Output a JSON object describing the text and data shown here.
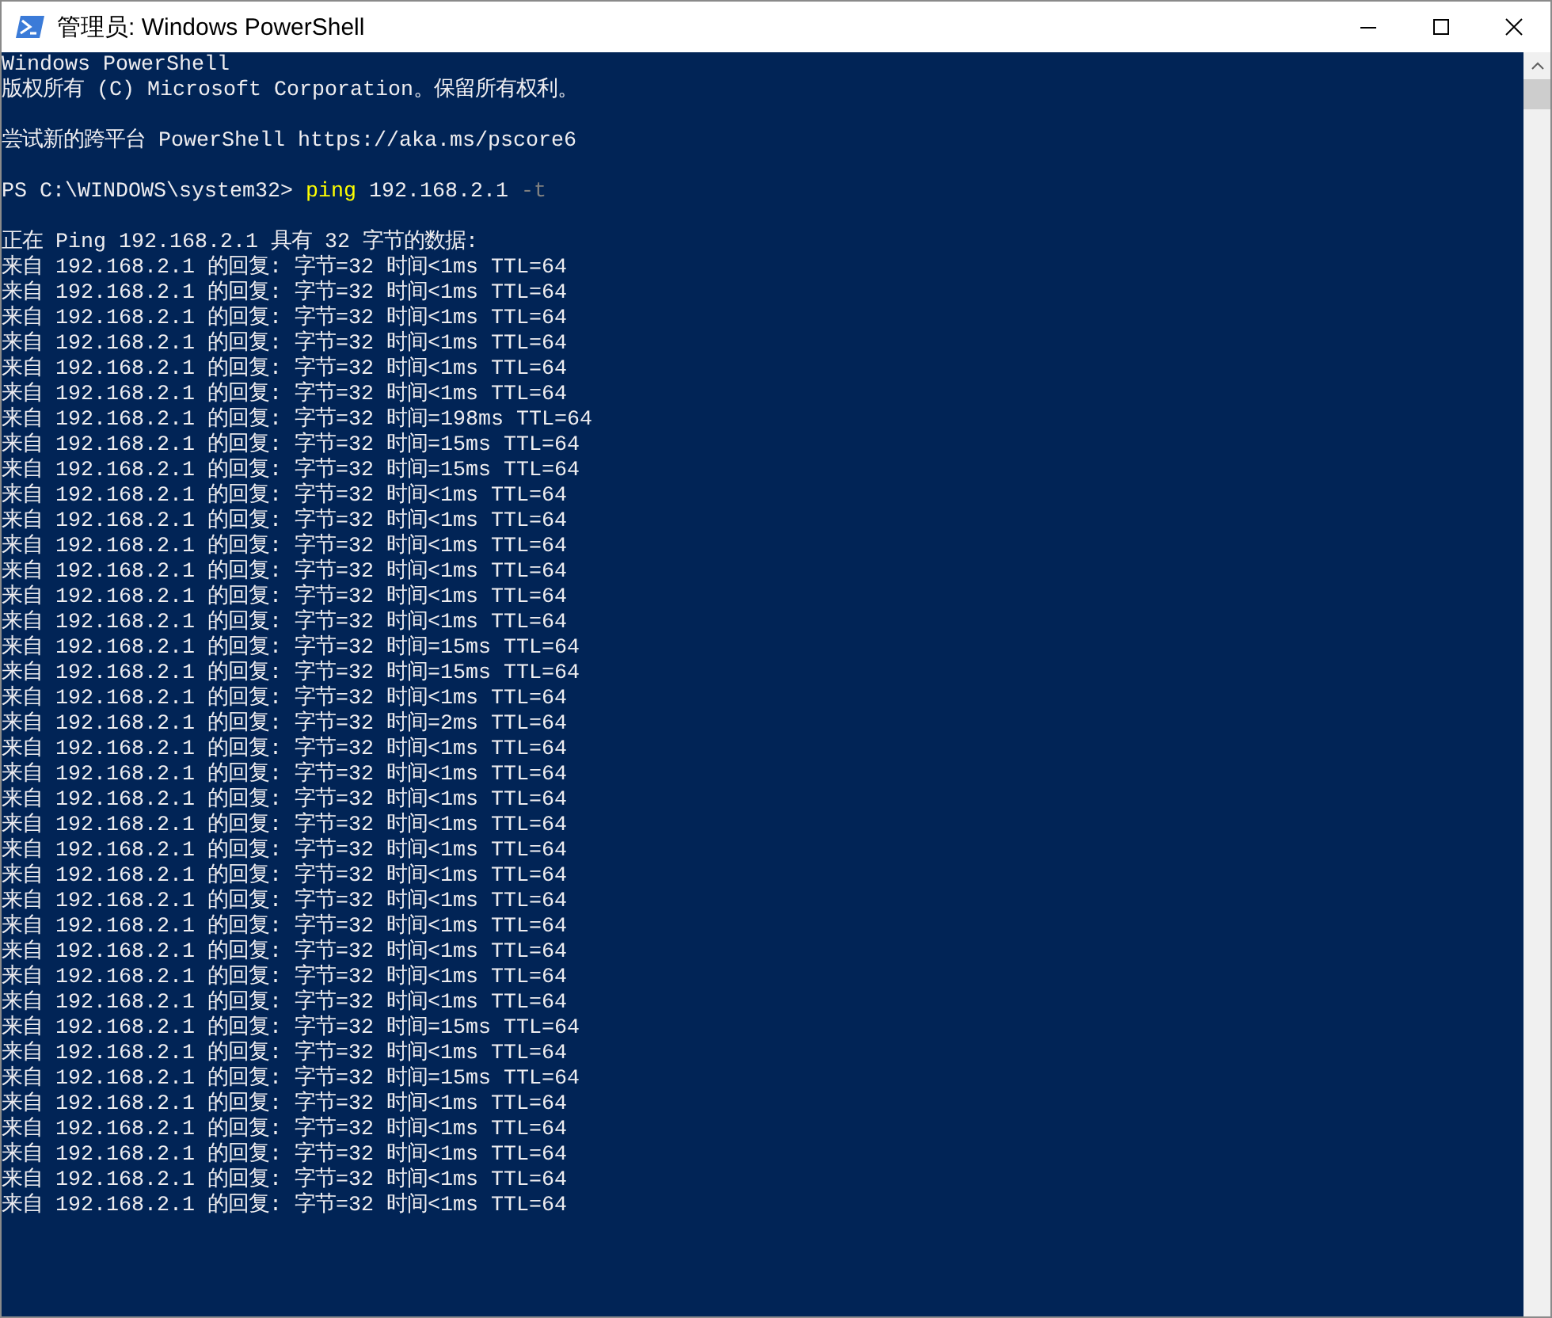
{
  "window": {
    "title": "管理员: Windows PowerShell"
  },
  "console": {
    "blocks": [
      {
        "kind": "text",
        "lines": [
          "Windows PowerShell",
          "版权所有 (C) Microsoft Corporation。保留所有权利。"
        ]
      },
      {
        "kind": "text",
        "lines": [
          "尝试新的跨平台 PowerShell https://aka.ms/pscore6"
        ]
      },
      {
        "kind": "command",
        "prompt": "PS C:\\WINDOWS\\system32>",
        "command": "ping",
        "argument": "192.168.2.1",
        "flag": "-t"
      },
      {
        "kind": "text",
        "lines": [
          "正在 Ping 192.168.2.1 具有 32 字节的数据:",
          "来自 192.168.2.1 的回复: 字节=32 时间<1ms TTL=64",
          "来自 192.168.2.1 的回复: 字节=32 时间<1ms TTL=64",
          "来自 192.168.2.1 的回复: 字节=32 时间<1ms TTL=64",
          "来自 192.168.2.1 的回复: 字节=32 时间<1ms TTL=64",
          "来自 192.168.2.1 的回复: 字节=32 时间<1ms TTL=64",
          "来自 192.168.2.1 的回复: 字节=32 时间<1ms TTL=64",
          "来自 192.168.2.1 的回复: 字节=32 时间=198ms TTL=64",
          "来自 192.168.2.1 的回复: 字节=32 时间=15ms TTL=64",
          "来自 192.168.2.1 的回复: 字节=32 时间=15ms TTL=64",
          "来自 192.168.2.1 的回复: 字节=32 时间<1ms TTL=64",
          "来自 192.168.2.1 的回复: 字节=32 时间<1ms TTL=64",
          "来自 192.168.2.1 的回复: 字节=32 时间<1ms TTL=64",
          "来自 192.168.2.1 的回复: 字节=32 时间<1ms TTL=64",
          "来自 192.168.2.1 的回复: 字节=32 时间<1ms TTL=64",
          "来自 192.168.2.1 的回复: 字节=32 时间<1ms TTL=64",
          "来自 192.168.2.1 的回复: 字节=32 时间=15ms TTL=64",
          "来自 192.168.2.1 的回复: 字节=32 时间=15ms TTL=64",
          "来自 192.168.2.1 的回复: 字节=32 时间<1ms TTL=64",
          "来自 192.168.2.1 的回复: 字节=32 时间=2ms TTL=64",
          "来自 192.168.2.1 的回复: 字节=32 时间<1ms TTL=64",
          "来自 192.168.2.1 的回复: 字节=32 时间<1ms TTL=64",
          "来自 192.168.2.1 的回复: 字节=32 时间<1ms TTL=64",
          "来自 192.168.2.1 的回复: 字节=32 时间<1ms TTL=64",
          "来自 192.168.2.1 的回复: 字节=32 时间<1ms TTL=64",
          "来自 192.168.2.1 的回复: 字节=32 时间<1ms TTL=64",
          "来自 192.168.2.1 的回复: 字节=32 时间<1ms TTL=64",
          "来自 192.168.2.1 的回复: 字节=32 时间<1ms TTL=64",
          "来自 192.168.2.1 的回复: 字节=32 时间<1ms TTL=64",
          "来自 192.168.2.1 的回复: 字节=32 时间<1ms TTL=64",
          "来自 192.168.2.1 的回复: 字节=32 时间<1ms TTL=64",
          "来自 192.168.2.1 的回复: 字节=32 时间=15ms TTL=64",
          "来自 192.168.2.1 的回复: 字节=32 时间<1ms TTL=64",
          "来自 192.168.2.1 的回复: 字节=32 时间=15ms TTL=64",
          "来自 192.168.2.1 的回复: 字节=32 时间<1ms TTL=64",
          "来自 192.168.2.1 的回复: 字节=32 时间<1ms TTL=64",
          "来自 192.168.2.1 的回复: 字节=32 时间<1ms TTL=64",
          "来自 192.168.2.1 的回复: 字节=32 时间<1ms TTL=64",
          "来自 192.168.2.1 的回复: 字节=32 时间<1ms TTL=64"
        ]
      }
    ]
  }
}
